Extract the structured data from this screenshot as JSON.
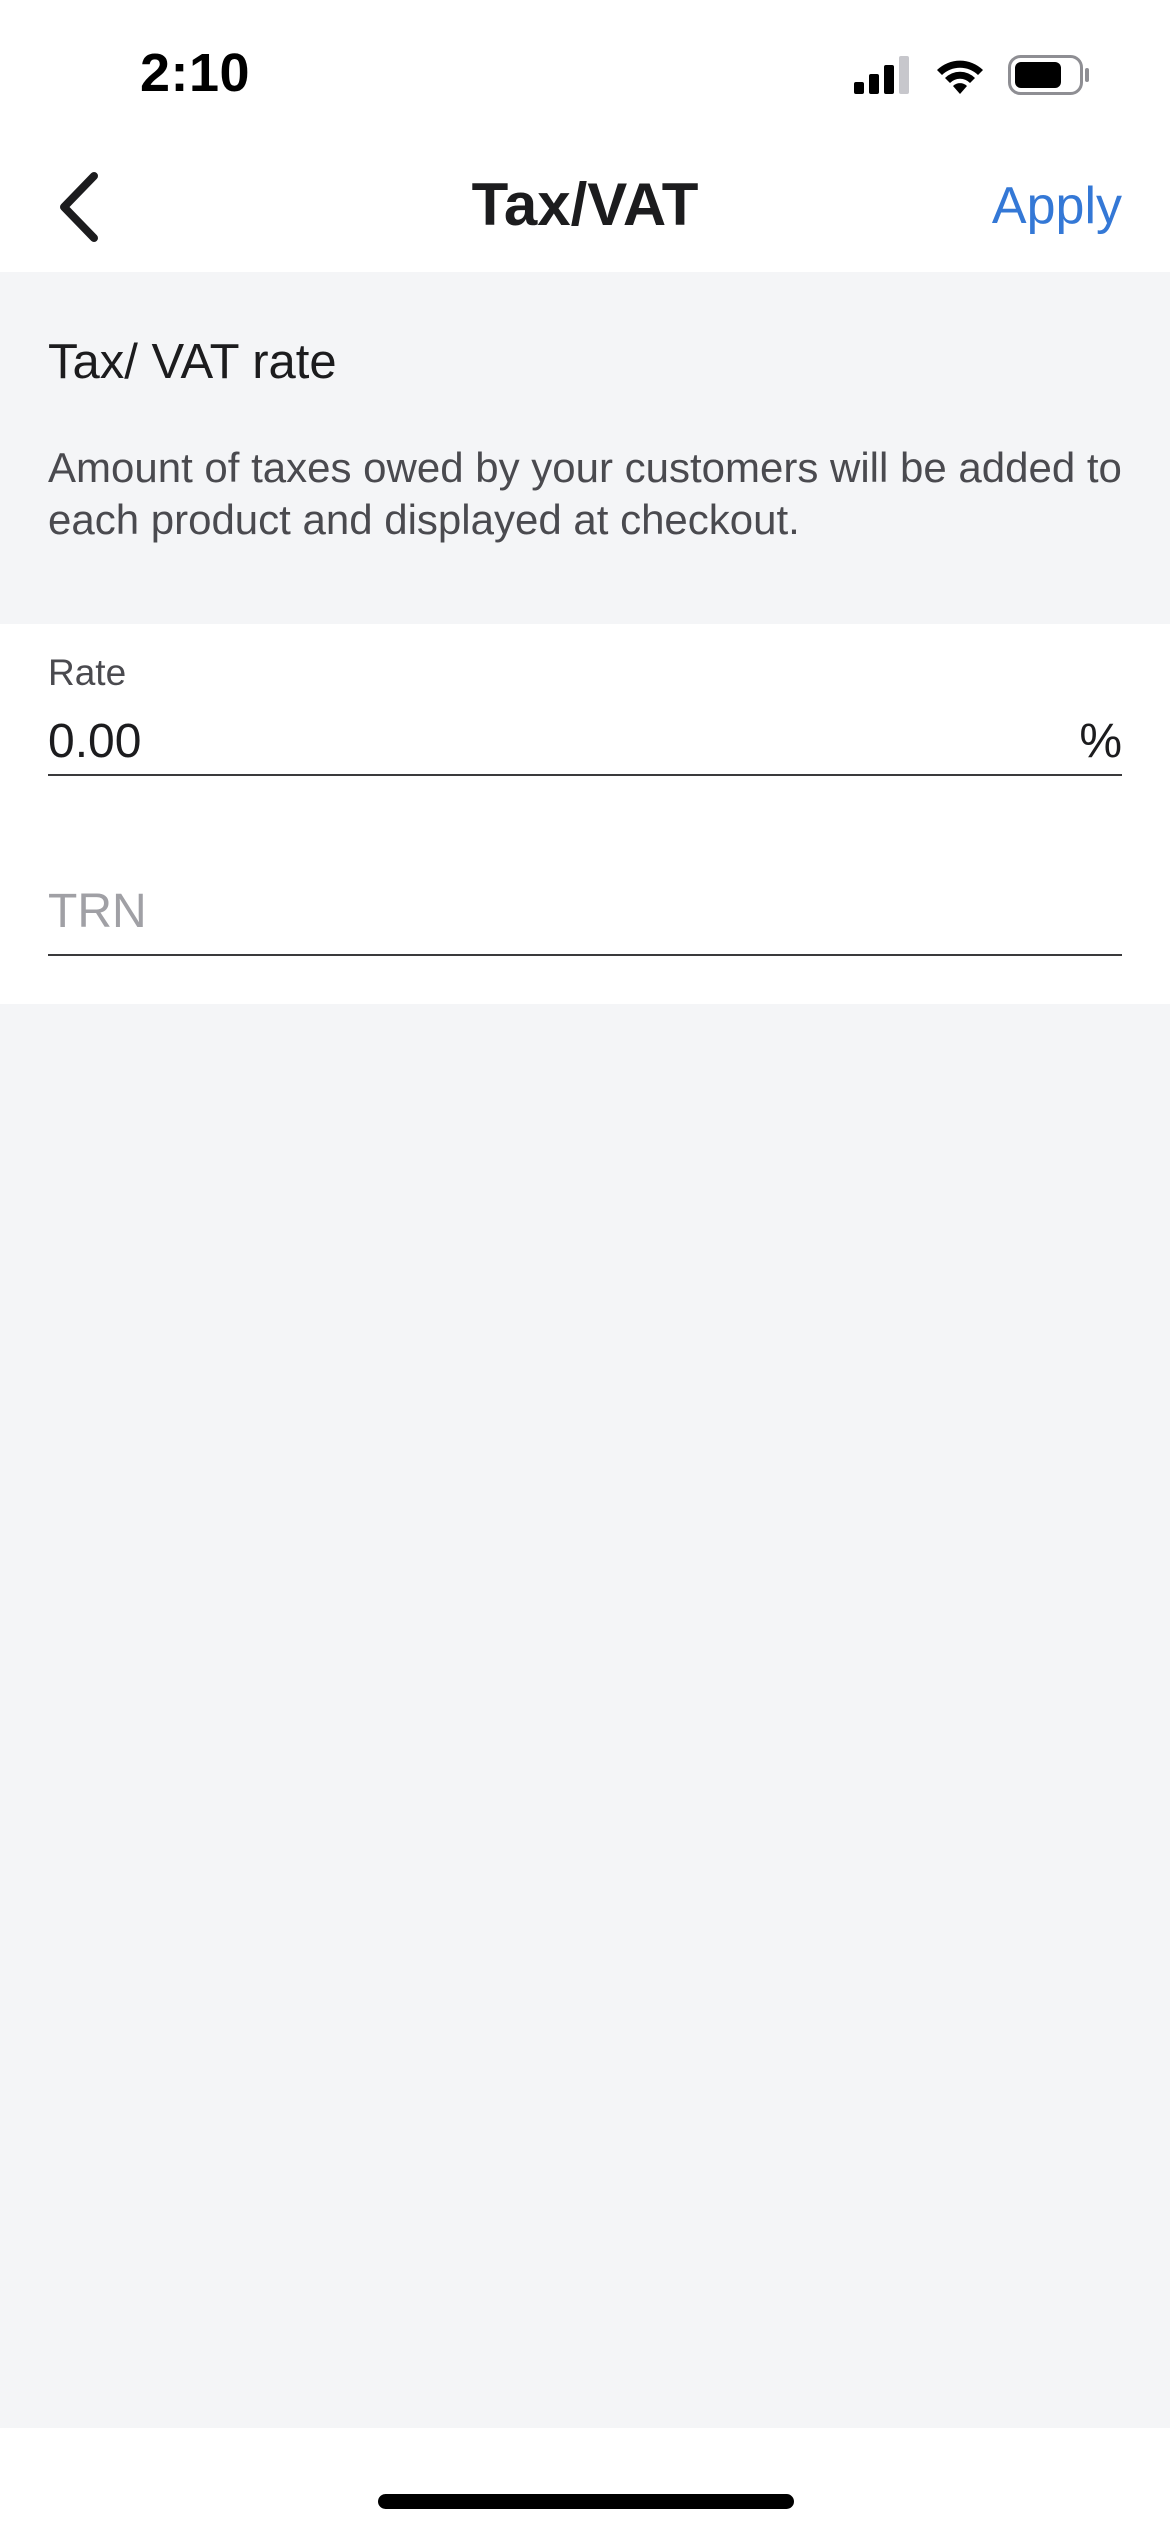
{
  "status_bar": {
    "time": "2:10",
    "icons": [
      "signal-icon",
      "wifi-icon",
      "battery-icon"
    ]
  },
  "nav": {
    "title": "Tax/VAT",
    "back_icon": "chevron-left-icon",
    "apply_label": "Apply"
  },
  "info": {
    "heading": "Tax/ VAT rate",
    "description": "Amount of taxes owed by your customers will be added to each product and displayed at checkout."
  },
  "form": {
    "rate": {
      "label": "Rate",
      "value": "0.00",
      "suffix": "%"
    },
    "trn": {
      "placeholder": "TRN",
      "value": ""
    }
  },
  "colors": {
    "accent": "#3478d6",
    "background": "#f4f5f7",
    "text": "#1c1c1e"
  }
}
